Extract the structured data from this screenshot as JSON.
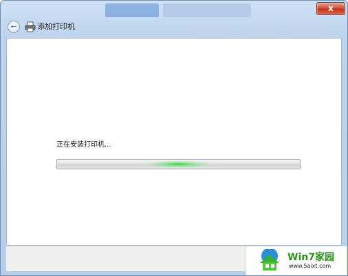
{
  "window": {
    "close_label": "x",
    "nav_title": "添加打印机"
  },
  "content": {
    "status_text": "正在安装打印机...",
    "progress_state": "indeterminate"
  },
  "watermark": {
    "brand": "Win7家园",
    "url": "www.5aixt.com"
  },
  "icons": {
    "back": "back-arrow-icon",
    "printer": "printer-icon",
    "close": "close-icon",
    "logo": "house-logo-icon"
  },
  "colors": {
    "title_bar": "#bcd3ec",
    "close_button": "#c9402a",
    "progress_glow": "#28d73c",
    "brand_green": "#2d8f1e"
  }
}
